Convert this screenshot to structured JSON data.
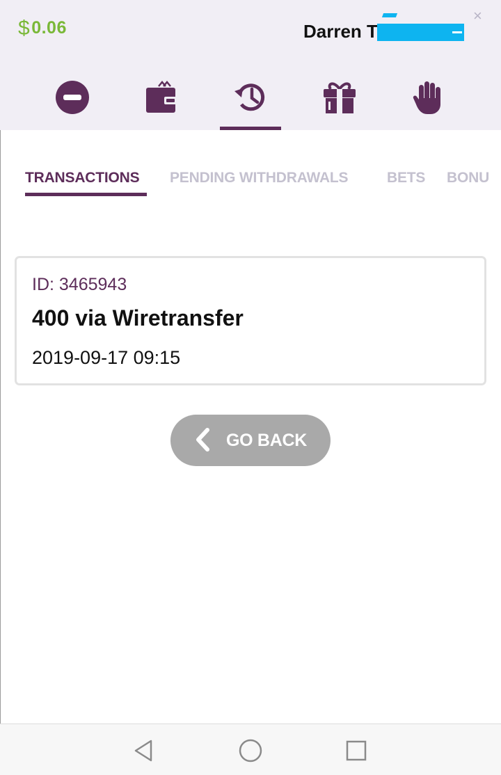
{
  "header": {
    "balance_currency": "$",
    "balance_amount": "0.06",
    "user_name": "Darren T",
    "close_symbol": "×"
  },
  "nav": {
    "items": [
      {
        "icon": "minus-circle-icon"
      },
      {
        "icon": "wallet-icon"
      },
      {
        "icon": "history-icon",
        "active": true
      },
      {
        "icon": "gift-icon"
      },
      {
        "icon": "hand-stop-icon"
      }
    ]
  },
  "tabs": [
    {
      "label": "TRANSACTIONS",
      "active": true
    },
    {
      "label": "PENDING WITHDRAWALS"
    },
    {
      "label": "BETS"
    },
    {
      "label": "BONU"
    }
  ],
  "transaction": {
    "id_label": "ID: 3465943",
    "title": "400 via Wiretransfer",
    "datetime": "2019-09-17 09:15"
  },
  "go_back": {
    "label": "GO BACK",
    "icon": "chevron-left-icon"
  },
  "system_nav": {
    "buttons": [
      "back-triangle-icon",
      "home-circle-icon",
      "recents-square-icon"
    ]
  },
  "colors": {
    "brand_purple": "#5d2d5a",
    "balance_green": "#7ab838",
    "header_bg": "#f1eef5",
    "tab_inactive": "#c4c1cf",
    "button_gray": "#a9a9a9"
  }
}
